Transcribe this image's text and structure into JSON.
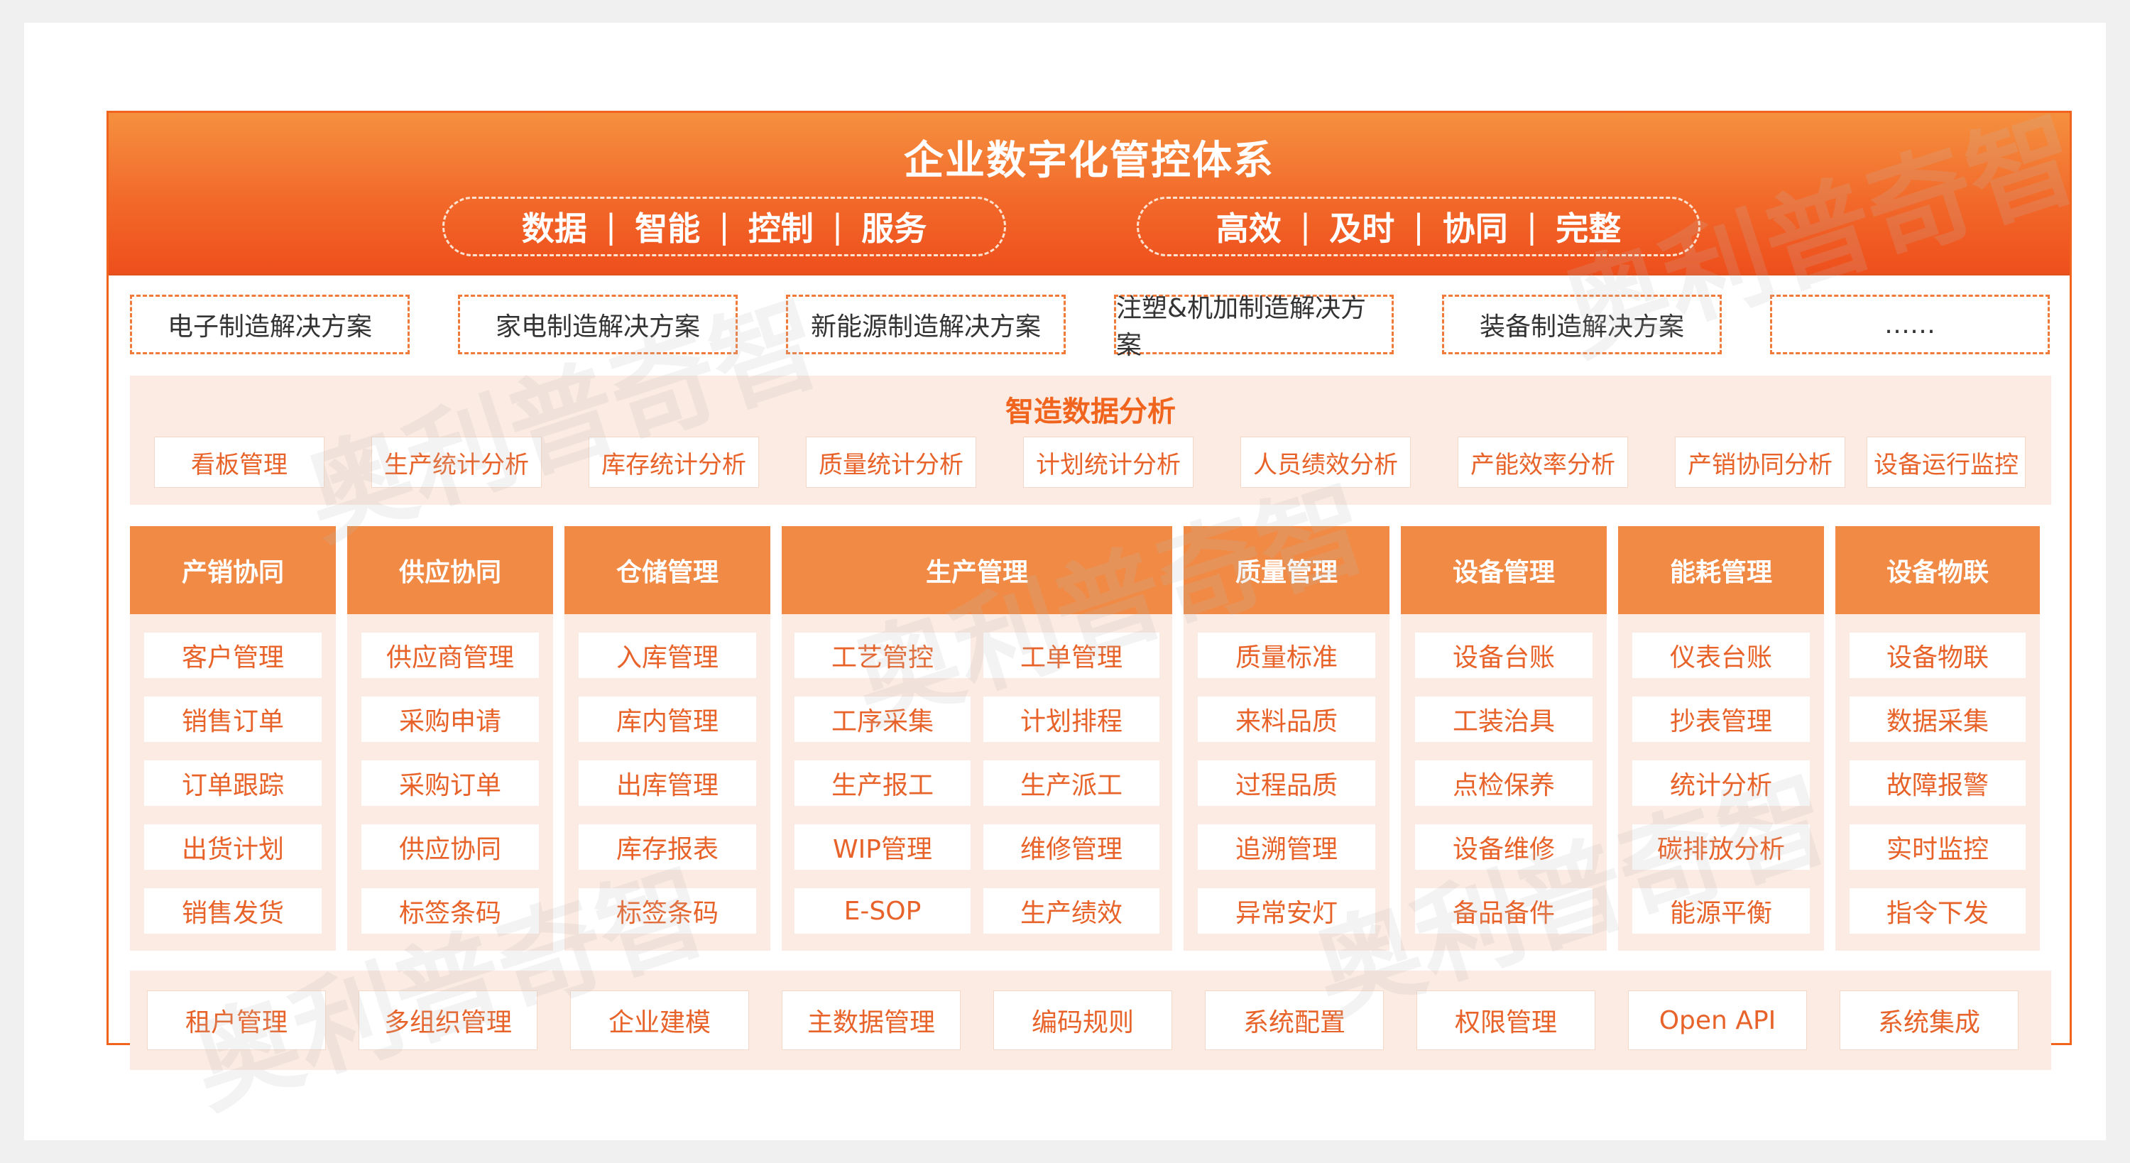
{
  "header": {
    "title": "企业数字化管控体系",
    "left_keywords": [
      "数据",
      "智能",
      "控制",
      "服务"
    ],
    "right_keywords": [
      "高效",
      "及时",
      "协同",
      "完整"
    ],
    "separator": "|"
  },
  "solutions": [
    "电子制造解决方案",
    "家电制造解决方案",
    "新能源制造解决方案",
    "注塑&机加制造解决方案",
    "装备制造解决方案",
    "……"
  ],
  "analysis": {
    "title": "智造数据分析",
    "items": [
      "看板管理",
      "生产统计分析",
      "库存统计分析",
      "质量统计分析",
      "计划统计分析",
      "人员绩效分析",
      "产能效率分析",
      "产销协同分析",
      "设备运行监控"
    ]
  },
  "modules": [
    {
      "title": "产销协同",
      "items": [
        "客户管理",
        "销售订单",
        "订单跟踪",
        "出货计划",
        "销售发货"
      ]
    },
    {
      "title": "供应协同",
      "items": [
        "供应商管理",
        "采购申请",
        "采购订单",
        "供应协同",
        "标签条码"
      ]
    },
    {
      "title": "仓储管理",
      "items": [
        "入库管理",
        "库内管理",
        "出库管理",
        "库存报表",
        "标签条码"
      ]
    },
    {
      "title": "生产管理",
      "items": [
        "工艺管控",
        "工单管理",
        "工序采集",
        "计划排程",
        "生产报工",
        "生产派工",
        "WIP管理",
        "维修管理",
        "E-SOP",
        "生产绩效"
      ]
    },
    {
      "title": "质量管理",
      "items": [
        "质量标准",
        "来料品质",
        "过程品质",
        "追溯管理",
        "异常安灯"
      ]
    },
    {
      "title": "设备管理",
      "items": [
        "设备台账",
        "工装治具",
        "点检保养",
        "设备维修",
        "备品备件"
      ]
    },
    {
      "title": "能耗管理",
      "items": [
        "仪表台账",
        "抄表管理",
        "统计分析",
        "碳排放分析",
        "能源平衡"
      ]
    },
    {
      "title": "设备物联",
      "items": [
        "设备物联",
        "数据采集",
        "故障报警",
        "实时监控",
        "指令下发"
      ]
    }
  ],
  "platform": [
    "租户管理",
    "多组织管理",
    "企业建模",
    "主数据管理",
    "编码规则",
    "系统配置",
    "权限管理",
    "Open API",
    "系统集成"
  ],
  "watermark": "奥利普奇智",
  "colors": {
    "accent": "#f0641e",
    "header_light": "#f5903f",
    "band_bg": "#fcebe2",
    "column_head": "#f08a45"
  }
}
